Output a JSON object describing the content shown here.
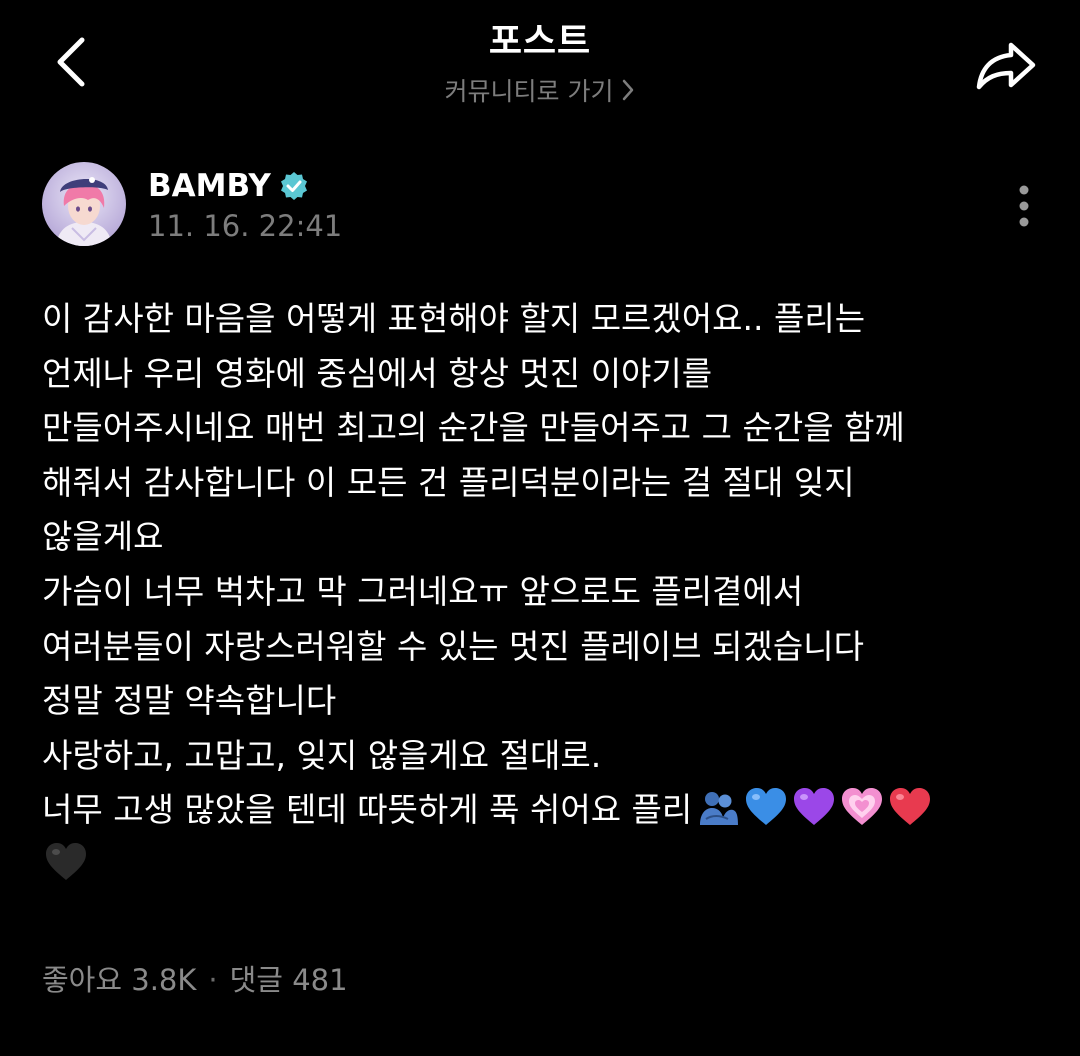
{
  "header": {
    "title": "포스트",
    "community_link": "커뮤니티로 가기"
  },
  "post": {
    "author": "BAMBY",
    "timestamp": "11. 16. 22:41",
    "body_lines": [
      "이 감사한 마음을 어떻게 표현해야 할지 모르겠어요.. 플리는",
      "언제나 우리 영화에 중심에서 항상 멋진 이야기를",
      "만들어주시네요 매번 최고의 순간을 만들어주고 그 순간을 함께",
      "해줘서 감사합니다 이 모든 건 플리덕분이라는 걸 절대 잊지",
      "않을게요",
      "가슴이 너무 벅차고 막 그러네요ㅠ 앞으로도 플리곁에서",
      "여러분들이 자랑스러워할 수 있는 멋진 플레이브 되겠습니다",
      "정말 정말 약속합니다",
      "사랑하고, 고맙고, 잊지 않을게요 절대로.",
      "너무 고생 많았을 텐데 따뜻하게 푹 쉬어요 플리"
    ],
    "emojis": [
      "hugging-people-emoji",
      "blue-heart-emoji",
      "purple-heart-emoji",
      "growing-heart-emoji",
      "red-heart-emoji",
      "black-heart-emoji"
    ]
  },
  "stats": {
    "likes_label": "좋아요",
    "likes_count": "3.8K",
    "separator": "·",
    "comments_label": "댓글",
    "comments_count": "481"
  },
  "colors": {
    "background": "#000000",
    "text": "#ffffff",
    "muted": "#7d7d7d",
    "verified": "#5bc7d3",
    "blue_heart": "#3a8ee6",
    "purple_heart": "#9b47e8",
    "pink_heart": "#f38fd0",
    "red_heart": "#e83a4f",
    "black_heart": "#2a2a2a"
  }
}
